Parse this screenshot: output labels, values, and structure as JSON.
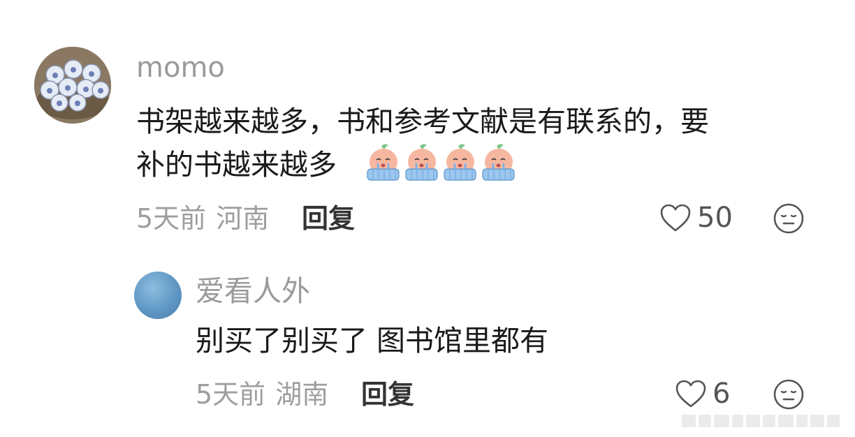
{
  "comment": {
    "username": "momo",
    "text_line1": "书架越来越多，书和参考文献是有联系的，要",
    "text_line2": "补的书越来越多",
    "sticker_icons": [
      "crying-peach-sticker-icon",
      "crying-peach-sticker-icon",
      "crying-peach-sticker-icon",
      "crying-peach-sticker-icon"
    ],
    "time": "5天前",
    "location": "河南",
    "reply_label": "回复",
    "like_count": "50",
    "avatar_icon": "ball-basket-avatar"
  },
  "reply": {
    "username": "爱看人外",
    "text": "别买了别买了 图书馆里都有",
    "time": "5天前",
    "location": "湖南",
    "reply_label": "回复",
    "like_count": "6",
    "avatar_color": "#6ba3cf"
  },
  "icons": {
    "like": "heart-outline-icon",
    "dislike": "neutral-face-icon"
  }
}
